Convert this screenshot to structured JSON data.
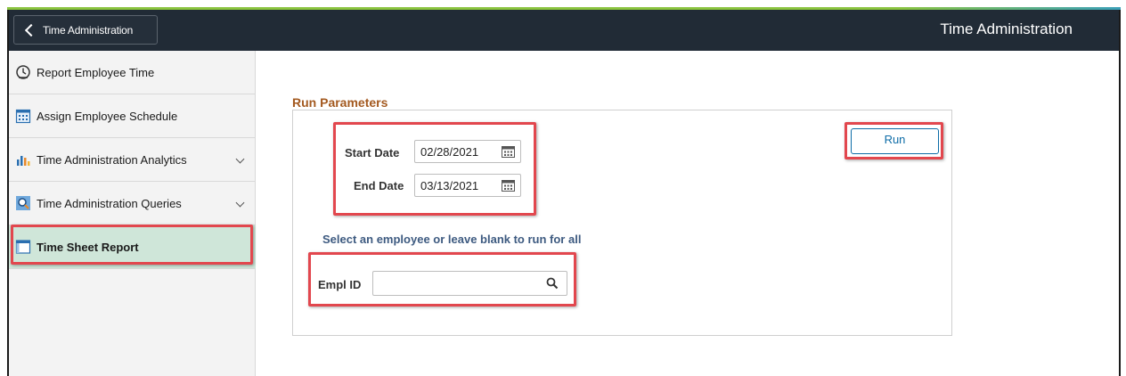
{
  "header": {
    "back_label": "Time Administration",
    "title": "Time Administration"
  },
  "sidebar": {
    "items": [
      {
        "label": "Report Employee Time",
        "icon": "clock-icon"
      },
      {
        "label": "Assign Employee Schedule",
        "icon": "calendar-icon"
      },
      {
        "label": "Time Administration Analytics",
        "icon": "bar-chart-icon",
        "expandable": true
      },
      {
        "label": "Time Administration Queries",
        "icon": "query-icon",
        "expandable": true
      },
      {
        "label": "Time Sheet Report",
        "icon": "report-icon",
        "active": true
      }
    ]
  },
  "main": {
    "section_title": "Run Parameters",
    "start_date_label": "Start Date",
    "start_date_value": "02/28/2021",
    "end_date_label": "End Date",
    "end_date_value": "03/13/2021",
    "run_label": "Run",
    "select_hint": "Select an employee or leave blank to run for all",
    "empl_id_label": "Empl ID",
    "empl_id_value": ""
  },
  "colors": {
    "header_bg": "#212b36",
    "active_item_bg": "#cfe6d9",
    "highlight_border": "#e2474e",
    "section_title": "#a3591f",
    "link_blue": "#0d6ca7"
  }
}
